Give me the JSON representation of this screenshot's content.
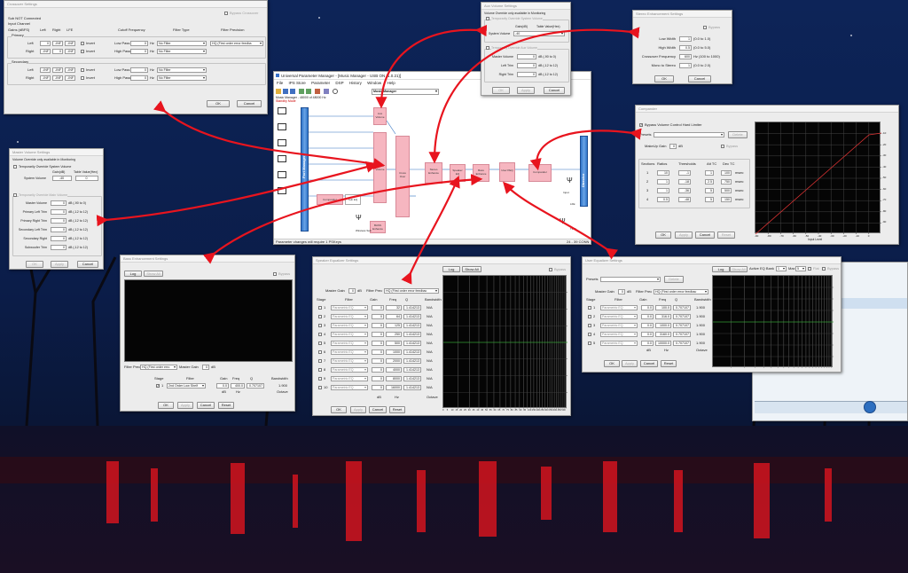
{
  "crossover": {
    "title": "Crossover Settings",
    "bypass": "Bypass Crossover",
    "sub_not_connected": "Sub NOT Connected",
    "input_channel": "Input Channel",
    "gains_hdr": "Gains (dBFS)",
    "col_left": "Left",
    "col_right": "Right",
    "col_lfe": "LFE",
    "col_cutoff": "Cutoff Frequency",
    "col_filter_type": "Filter Type",
    "col_filter_precision": "Filter Precision",
    "primary": "Primary",
    "secondary": "Secondary",
    "row_left": "Left",
    "row_right": "Right",
    "v_0": "0",
    "v_inf": "-INF",
    "invert": "Invert",
    "low_pass": "Low Pass",
    "high_pass": "High Pass",
    "hz": "Hz",
    "no_filter": "No Filter",
    "precision": "HQ (First order error feedba",
    "ok": "OK",
    "cancel": "Cancel"
  },
  "master_volume": {
    "title": "Master Volume Settings",
    "note": "Volume Override only available in Monitoring",
    "override_system": "Temporarily Override System Volume",
    "gain_db": "Gain(dB)",
    "table_value": "Table Value(Hex)",
    "system_volume": "System Volume",
    "sv_gain": "-40",
    "sv_hex": "0",
    "override_main": "Temporarily Override Main Volume",
    "rows": [
      {
        "label": "Master Volume",
        "value": "0",
        "range": "dB (-90 to 0)"
      },
      {
        "label": "Primary Left Trim",
        "value": "0",
        "range": "dB (-12 to 12)"
      },
      {
        "label": "Primary Right Trim",
        "value": "0",
        "range": "dB (-12 to 12)"
      },
      {
        "label": "Secondary Left Trim",
        "value": "0",
        "range": "dB (-12 to 12)"
      },
      {
        "label": "Secondary Right",
        "value": "0",
        "range": "dB (-12 to 12)"
      },
      {
        "label": "Subwoofer Trim",
        "value": "0",
        "range": "dB (-12 to 12)"
      }
    ],
    "ok": "OK",
    "apply": "Apply",
    "cancel": "Cancel"
  },
  "main_window": {
    "title": "Universal Parameter Manager - [Music Manager - USB ON (1.0.21)]",
    "menu": [
      "File",
      "IPS Store",
      "Parameter",
      "DSP",
      "History",
      "Window",
      "Help"
    ],
    "preset_combo": "Music Manager",
    "info1": "Music Manager - 48000 of 48000 Hz",
    "info2": "Standby Mode",
    "port_manager": "Port Manager",
    "director": "Director",
    "blocks": {
      "aux_volume": "Aux Volume",
      "master_volume": "Master Volume",
      "cross_over": "Cross Over",
      "stereo_enhance": "Stereo Enhance",
      "speaker_eq": "Speaker EQ",
      "bass_enhance": "Bass Enhance",
      "user_peq": "User PEQ",
      "compander": "Compander",
      "compander2": "Compander",
      "sub_eq": "Sub EQ",
      "bass_enhance2": "BASS Enhance",
      "wireless_sub": "Wireless Sub",
      "input": "Input",
      "lfe": "LFE",
      "tws": "TWS"
    },
    "status_left": "Parameter changes will require 1 PSKeys",
    "status_right": "24 - 39 CONN"
  },
  "aux_volume": {
    "title": "Aux Volume Settings",
    "note": "Volume Override only available in Monitoring",
    "override_system": "Temporarily Override System Volume",
    "gain_db": "Gain(dB)",
    "table_value": "Table Value(Hex)",
    "system_volume": "System Volume",
    "sv_gain": "-40",
    "override_aux": "Temporarily Override Aux Volume",
    "rows": [
      {
        "label": "Master Volume",
        "value": "0",
        "range": "dB (-90 to 0)"
      },
      {
        "label": "Left Trim",
        "value": "0",
        "range": "dB (-12 to 12)"
      },
      {
        "label": "Right Trim",
        "value": "0",
        "range": "dB (-12 to 12)"
      }
    ],
    "ok": "OK",
    "apply": "Apply",
    "cancel": "Cancel"
  },
  "stereo_enh": {
    "title": "Stereo Enhancement Settings",
    "bypass": "Bypass",
    "rows": [
      {
        "label": "Low Width",
        "value": "1",
        "range": "(0.0 to 1.0)"
      },
      {
        "label": "High Width",
        "value": "0.5",
        "range": "(0.0 to 5.0)"
      },
      {
        "label": "Crossover Frequency",
        "value": "600",
        "range": "Hz (100 to 1000)"
      },
      {
        "label": "Mono to Stereo",
        "value": "1",
        "range": "(0.0 to 2.0)"
      }
    ],
    "ok": "OK",
    "cancel": "Cancel"
  },
  "compander": {
    "title": "Compander",
    "bypass_volume": "Bypass Volume Control Hard Limiter",
    "presets": "Presets",
    "delete": "Delete",
    "makeup_gain": "MakeUp Gain",
    "makeup_value": "0",
    "db": "dB",
    "bypass": "Bypass",
    "hdr": [
      "Sections",
      "Ratios",
      "Thresholds",
      "Att TC",
      "Dec TC"
    ],
    "rows": [
      {
        "n": "1",
        "ratio": "10",
        "thr": "-1",
        "att": "1",
        "dec": "100"
      },
      {
        "n": "2",
        "ratio": "1",
        "thr": "-18",
        "att": "2.5",
        "dec": "750"
      },
      {
        "n": "3",
        "ratio": "1",
        "thr": "-36",
        "att": "5",
        "dec": "500"
      },
      {
        "n": "4",
        "ratio": "0.5",
        "thr": "-48",
        "att": "5",
        "dec": "150"
      }
    ],
    "msec": "msec",
    "x_label": "Input Level",
    "y_ticks": [
      "-10",
      "-20",
      "-30",
      "-40",
      "-50",
      "-60",
      "-70",
      "-80",
      "-90"
    ],
    "x_ticks": [
      "-90",
      "-80",
      "-70",
      "-60",
      "-50",
      "-40",
      "-30",
      "-20",
      "-10",
      "0"
    ],
    "ok": "OK",
    "apply": "Apply",
    "cancel": "Cancel",
    "reset": "Reset"
  },
  "bass_enh": {
    "title": "Bass Enhancement Settings",
    "log": "Log",
    "show_all": "Show All",
    "bypass": "Bypass",
    "filter_prec_label": "Filter Prec",
    "filter_prec": "HQ (First order erro",
    "master_gain": "Master Gain",
    "master_gain_val": "0",
    "db": "dB",
    "hdr": [
      "Stage",
      "Filter",
      "Gain",
      "Freq",
      "Q",
      "Bandwidth"
    ],
    "row": {
      "n": "1",
      "filter": "2nd Order Low Shelf",
      "gain": "0.0",
      "freq": "400.0",
      "q": "0.707107",
      "bw": "1.900"
    },
    "units": [
      "dB",
      "Hz",
      "Octave"
    ],
    "ok": "OK",
    "apply": "Apply",
    "cancel": "Cancel",
    "reset": "Reset"
  },
  "speaker_eq": {
    "title": "Speaker Equalizer Settings",
    "master_gain": "Master Gain",
    "master_gain_val": "0",
    "db": "dB",
    "filter_prec_label": "Filter Prec",
    "filter_prec": "HQ (First order error feedbac",
    "log": "Log",
    "show_all": "Show All",
    "bypass": "Bypass",
    "hdr": [
      "Stage",
      "Filter",
      "Gain",
      "Freq",
      "Q",
      "Bandwidth"
    ],
    "rows": [
      {
        "n": "1",
        "filter": "Parametric EQ",
        "gain": "0",
        "freq": "32",
        "q": "1.414213",
        "bw": "N/A"
      },
      {
        "n": "2",
        "filter": "Parametric EQ",
        "gain": "0",
        "freq": "64",
        "q": "1.414213",
        "bw": "N/A"
      },
      {
        "n": "3",
        "filter": "Parametric EQ",
        "gain": "0",
        "freq": "125",
        "q": "1.414213",
        "bw": "N/A"
      },
      {
        "n": "4",
        "filter": "Parametric EQ",
        "gain": "0",
        "freq": "250",
        "q": "1.414213",
        "bw": "N/A"
      },
      {
        "n": "5",
        "filter": "Parametric EQ",
        "gain": "0",
        "freq": "500",
        "q": "1.414213",
        "bw": "N/A"
      },
      {
        "n": "6",
        "filter": "Parametric EQ",
        "gain": "0",
        "freq": "1000",
        "q": "1.414213",
        "bw": "N/A"
      },
      {
        "n": "7",
        "filter": "Parametric EQ",
        "gain": "0",
        "freq": "2000",
        "q": "1.414213",
        "bw": "N/A"
      },
      {
        "n": "8",
        "filter": "Parametric EQ",
        "gain": "0",
        "freq": "4000",
        "q": "1.414213",
        "bw": "N/A"
      },
      {
        "n": "9",
        "filter": "Parametric EQ",
        "gain": "0",
        "freq": "8000",
        "q": "1.414213",
        "bw": "N/A"
      },
      {
        "n": "10",
        "filter": "Parametric EQ",
        "gain": "0",
        "freq": "16000",
        "q": "1.414213",
        "bw": "N/A"
      }
    ],
    "units": [
      "dB",
      "Hz",
      "Octave"
    ],
    "x_ticks": [
      "0",
      "5",
      "10",
      "15",
      "20",
      "25",
      "30",
      "35",
      "40",
      "45",
      "50",
      "55",
      "60",
      "65",
      "70",
      "75",
      "80",
      "85",
      "90",
      "95",
      "100",
      "150",
      "200",
      "250",
      "300",
      "350",
      "400",
      "450",
      "500"
    ],
    "ok": "OK",
    "apply": "Apply",
    "cancel": "Cancel",
    "reset": "Reset"
  },
  "user_eq": {
    "title": "User Equalizer Settings",
    "presets": "Presets",
    "delete": "Delete",
    "log": "Log",
    "show_all": "Show All",
    "active_eq_bank": "Active EQ Bank",
    "bank_val": "1",
    "max": "Max",
    "max_val": "5",
    "flat": "Flat",
    "bypass": "Bypass",
    "master_gain": "Master Gain",
    "master_gain_val": "0",
    "db": "dB",
    "filter_prec_label": "Filter Prec",
    "filter_prec": "HQ (First order error feedbac",
    "hdr": [
      "Stage",
      "Filter",
      "Gain",
      "Freq",
      "Q",
      "Bandwidth"
    ],
    "rows": [
      {
        "n": "1",
        "filter": "Parametric EQ",
        "gain": "0.0",
        "freq": "100.0",
        "q": "0.707107",
        "bw": "1.900"
      },
      {
        "n": "2",
        "filter": "Parametric EQ",
        "gain": "0.0",
        "freq": "316.0",
        "q": "0.707107",
        "bw": "1.900"
      },
      {
        "n": "3",
        "filter": "Parametric EQ",
        "gain": "0.0",
        "freq": "1000.0",
        "q": "0.707107",
        "bw": "1.900"
      },
      {
        "n": "4",
        "filter": "Parametric EQ",
        "gain": "0.0",
        "freq": "3160.0",
        "q": "0.707107",
        "bw": "1.900"
      },
      {
        "n": "5",
        "filter": "Parametric EQ",
        "gain": "0.0",
        "freq": "10000.0",
        "q": "0.707107",
        "bw": "1.900"
      }
    ],
    "units": [
      "dB",
      "Hz",
      "Octave"
    ],
    "ok": "OK",
    "apply": "Apply",
    "cancel": "Cancel",
    "reset": "Reset"
  },
  "colors": {
    "arrow": "#e8141e",
    "block_pink": "#f6b6c0",
    "blue_bar": "#2f74c8",
    "graph_bg": "#050505"
  }
}
